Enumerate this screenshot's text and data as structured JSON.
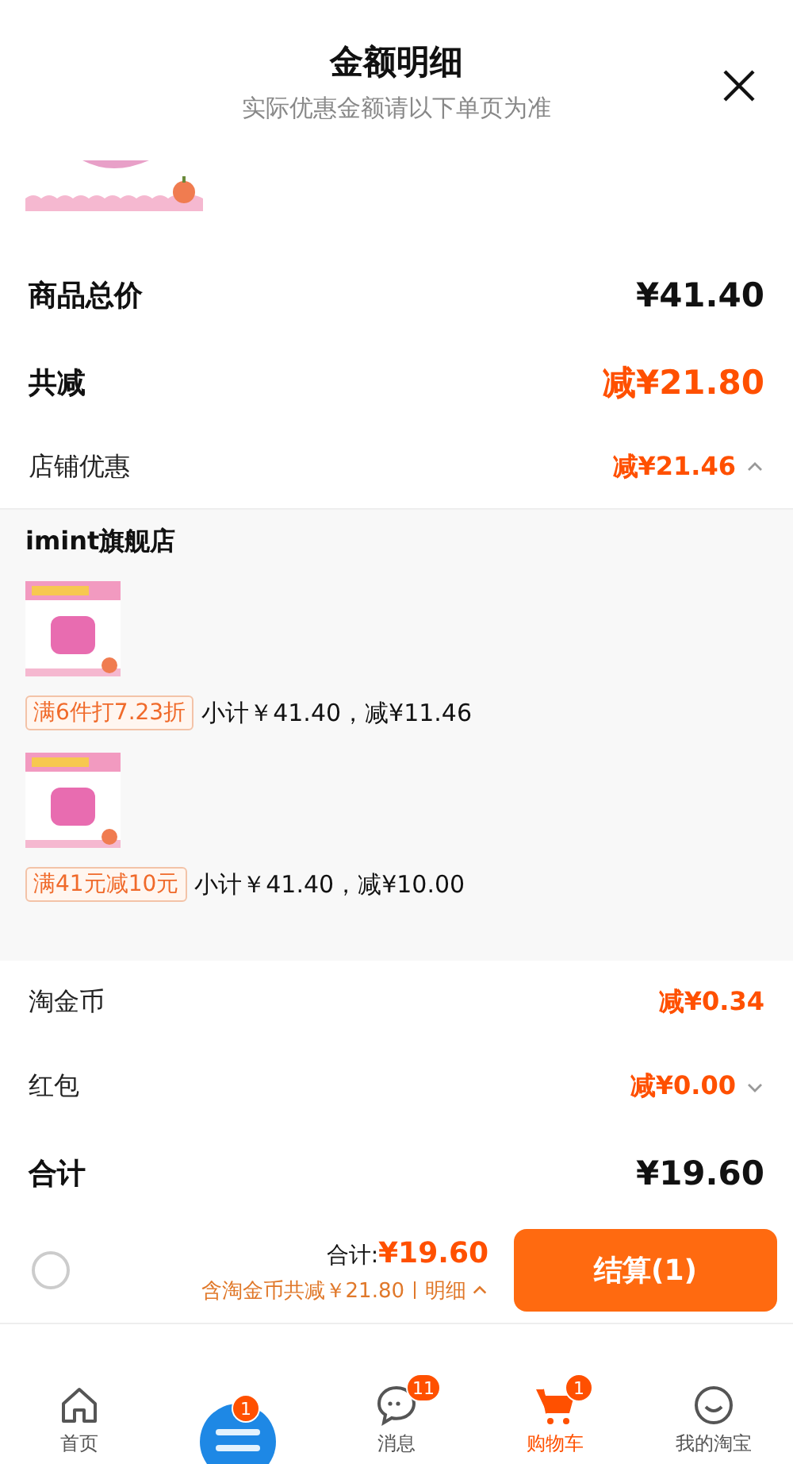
{
  "header": {
    "title": "金额明细",
    "subtitle": "实际优惠金额请以下单页为准"
  },
  "summary": [
    {
      "label": "商品总价",
      "value": "¥41.40",
      "kind": "total"
    },
    {
      "label": "共减",
      "value": "减¥21.80",
      "kind": "discount"
    }
  ],
  "store_discount": {
    "label": "店铺优惠",
    "value": "减¥21.46",
    "expanded": true,
    "store": "imint旗舰店",
    "items": [
      {
        "tag": "满6件打7.23折",
        "text": "小计￥41.40，减¥11.46"
      },
      {
        "tag": "满41元减10元",
        "text": "小计￥41.40，减¥10.00"
      }
    ]
  },
  "other_discounts": [
    {
      "label": "淘金币",
      "value": "减¥0.34",
      "kind": "plain"
    },
    {
      "label": "红包",
      "value": "减¥0.00",
      "kind": "dropdown",
      "expanded": false
    }
  ],
  "grand_total": {
    "label": "合计",
    "value": "¥19.60"
  },
  "checkout_bar": {
    "checked": false,
    "total_label": "合计:",
    "total": "¥19.60",
    "saving": "含淘金币共减￥21.80",
    "detail": "明细",
    "button": "结算(1)"
  },
  "tab_bar": [
    {
      "label": "首页",
      "kind": "home",
      "selected": false
    },
    {
      "kind": "promo",
      "badge": "1",
      "selected": false
    },
    {
      "label": "消息",
      "kind": "chat",
      "badge": "11",
      "selected": false
    },
    {
      "label": "购物车",
      "kind": "cart",
      "badge": "1",
      "selected": true
    },
    {
      "label": "我的淘宝",
      "kind": "face",
      "selected": false
    }
  ]
}
